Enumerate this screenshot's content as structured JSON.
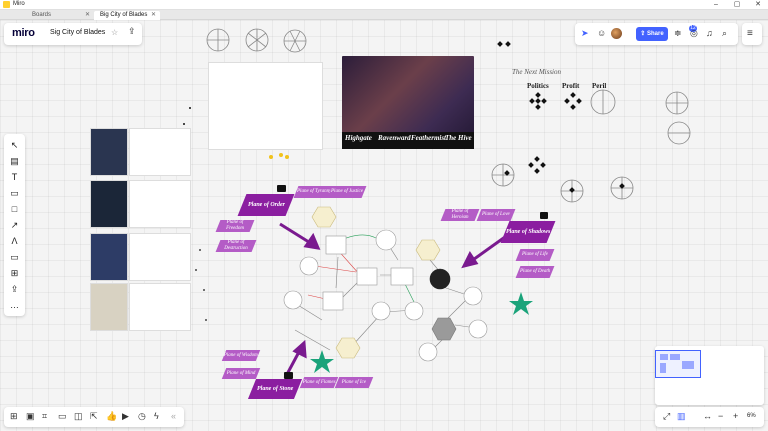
{
  "window": {
    "app_name": "Miro",
    "minimize": "–",
    "maximize": "▢",
    "close": "✕"
  },
  "tabs": [
    {
      "label": "Boards",
      "close": "✕"
    },
    {
      "label": "Big City of Blades",
      "close": "✕"
    }
  ],
  "header": {
    "logo": "miro",
    "board_title": "Sig City of Blades",
    "star_icon": "star-icon",
    "upload_icon": "upload-icon"
  },
  "top_right": {
    "share_label": "Share",
    "notification_count": "12",
    "accent": "#4262ff"
  },
  "toolbar": {
    "icons": [
      "cursor-icon",
      "frame-icon",
      "text-icon",
      "sticky-note-icon",
      "shape-icon",
      "pen-icon",
      "line-icon",
      "comment-icon",
      "crop-icon",
      "upload-icon",
      "more-icon"
    ],
    "glyphs": [
      "↖",
      "▤",
      "T",
      "▭",
      "□",
      "↗",
      "Λ",
      "▭",
      "⊞",
      "⇪",
      "…"
    ]
  },
  "bottom_left": {
    "icons": [
      "grid-icon",
      "card-icon",
      "kanban-icon",
      "comment-icon",
      "chat-icon",
      "share-icon",
      "like-icon",
      "video-icon",
      "timer-icon",
      "lightning-icon",
      "collapse-icon"
    ],
    "glyphs": [
      "⊞",
      "▣",
      "⌗",
      "▭",
      "◫",
      "⇱",
      "👍",
      "▶",
      "◷",
      "ϟ",
      "«"
    ]
  },
  "bottom_right": {
    "zoom_out": "−",
    "zoom_in": "+",
    "zoom": "6%",
    "fit": "⤢",
    "map": "▥",
    "ruler": "↔"
  },
  "board": {
    "next_mission_title": "The Next Mission",
    "mission_headers": [
      "Politics",
      "Profit",
      "Peril"
    ],
    "planes": {
      "order": "Plane of Order",
      "shadows": "Plane of Shadows",
      "stone": "Plane of Stone"
    },
    "small_planes": [
      "Plane of Tyranny",
      "Plane of Justice",
      "Plane of Freedom",
      "Plane of Destruction",
      "Plane of Heroism",
      "Plane of Love",
      "Plane of Life",
      "Plane of Death",
      "Plane of Wisdom",
      "Plane of Mind",
      "Plane of Flames",
      "Plane of Ice"
    ],
    "artwork_titles": [
      "Highgate",
      "Ravenward",
      "Feathermist",
      "The Hive"
    ]
  },
  "colors": {
    "plane_dark": "#8b1ea0",
    "plane_light": "#b45cc6",
    "hex_fill": "#f6efcf",
    "star_green": "#1aa37a",
    "node_dark": "#222222",
    "node_grey": "#9a9a9a"
  }
}
